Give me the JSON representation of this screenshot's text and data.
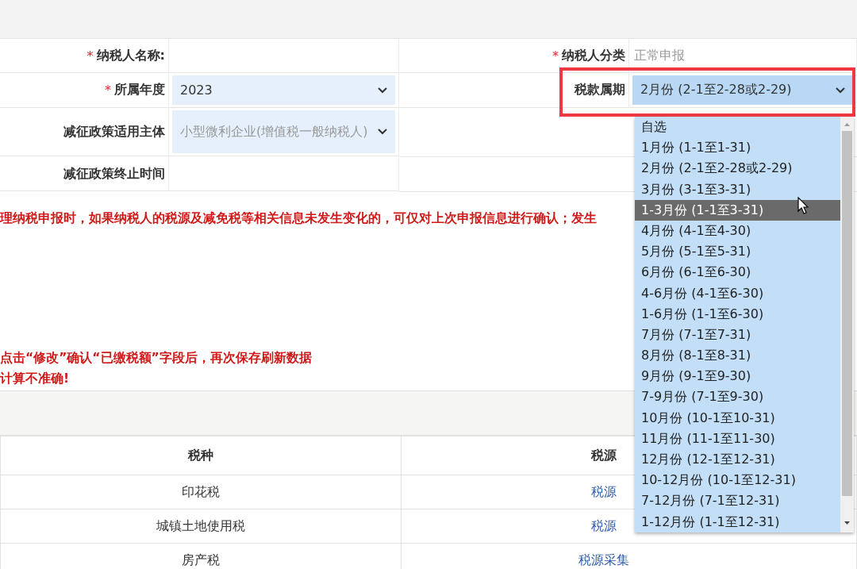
{
  "form_rows": [
    [
      {
        "required_mark": "*",
        "label": "纳税人名称:",
        "kind": "blank"
      },
      {
        "required_mark": "*",
        "label": "纳税人分类",
        "kind": "readonly",
        "value": "正常申报"
      }
    ],
    [
      {
        "required_mark": "*",
        "label": "所属年度",
        "kind": "select",
        "value": "2023",
        "disabled": false
      },
      {
        "label": "税款属期",
        "kind": "select",
        "value": "2月份 (2-1至2-28或2-29)",
        "disabled": false,
        "highlighted": true
      }
    ],
    [
      {
        "label": "减征政策适用主体",
        "kind": "select",
        "value": "小型微利企业(增值税一般纳税人)",
        "disabled": true
      }
    ],
    [
      {
        "label": "减征政策终止时间",
        "kind": "blank"
      }
    ]
  ],
  "notice": [
    "理纳税申报时，如果纳税人的税源及减免税等相关信息未发生变化的，可仅对上次申报信息进行确认；发生",
    "点击“修改”确认“已缴税额”字段后，再次保存刷新数据",
    "计算不准确!"
  ],
  "table": {
    "columns": [
      "税种",
      "税源"
    ],
    "rows": [
      {
        "tax": "印花税",
        "action": "税源"
      },
      {
        "tax": "城镇土地使用税",
        "action": "税源"
      },
      {
        "tax": "房产税",
        "action": "税源采集"
      }
    ]
  },
  "dropdown": {
    "options": [
      {
        "label": "自选",
        "selected": false
      },
      {
        "label": "1月份 (1-1至1-31)",
        "selected": false
      },
      {
        "label": "2月份 (2-1至2-28或2-29)",
        "selected": false
      },
      {
        "label": "3月份 (3-1至3-31)",
        "selected": false
      },
      {
        "label": "1-3月份 (1-1至3-31)",
        "selected": true
      },
      {
        "label": "4月份 (4-1至4-30)",
        "selected": false
      },
      {
        "label": "5月份 (5-1至5-31)",
        "selected": false
      },
      {
        "label": "6月份 (6-1至6-30)",
        "selected": false
      },
      {
        "label": "4-6月份 (4-1至6-30)",
        "selected": false
      },
      {
        "label": "1-6月份 (1-1至6-30)",
        "selected": false
      },
      {
        "label": "7月份 (7-1至7-31)",
        "selected": false
      },
      {
        "label": "8月份 (8-1至8-31)",
        "selected": false
      },
      {
        "label": "9月份 (9-1至9-30)",
        "selected": false
      },
      {
        "label": "7-9月份 (7-1至9-30)",
        "selected": false
      },
      {
        "label": "10月份 (10-1至10-31)",
        "selected": false
      },
      {
        "label": "11月份 (11-1至11-30)",
        "selected": false
      },
      {
        "label": "12月份 (12-1至12-31)",
        "selected": false
      },
      {
        "label": "10-12月份 (10-1至12-31)",
        "selected": false
      },
      {
        "label": "7-12月份 (7-1至12-31)",
        "selected": false
      },
      {
        "label": "1-12月份 (1-1至12-31)",
        "selected": false
      }
    ]
  }
}
